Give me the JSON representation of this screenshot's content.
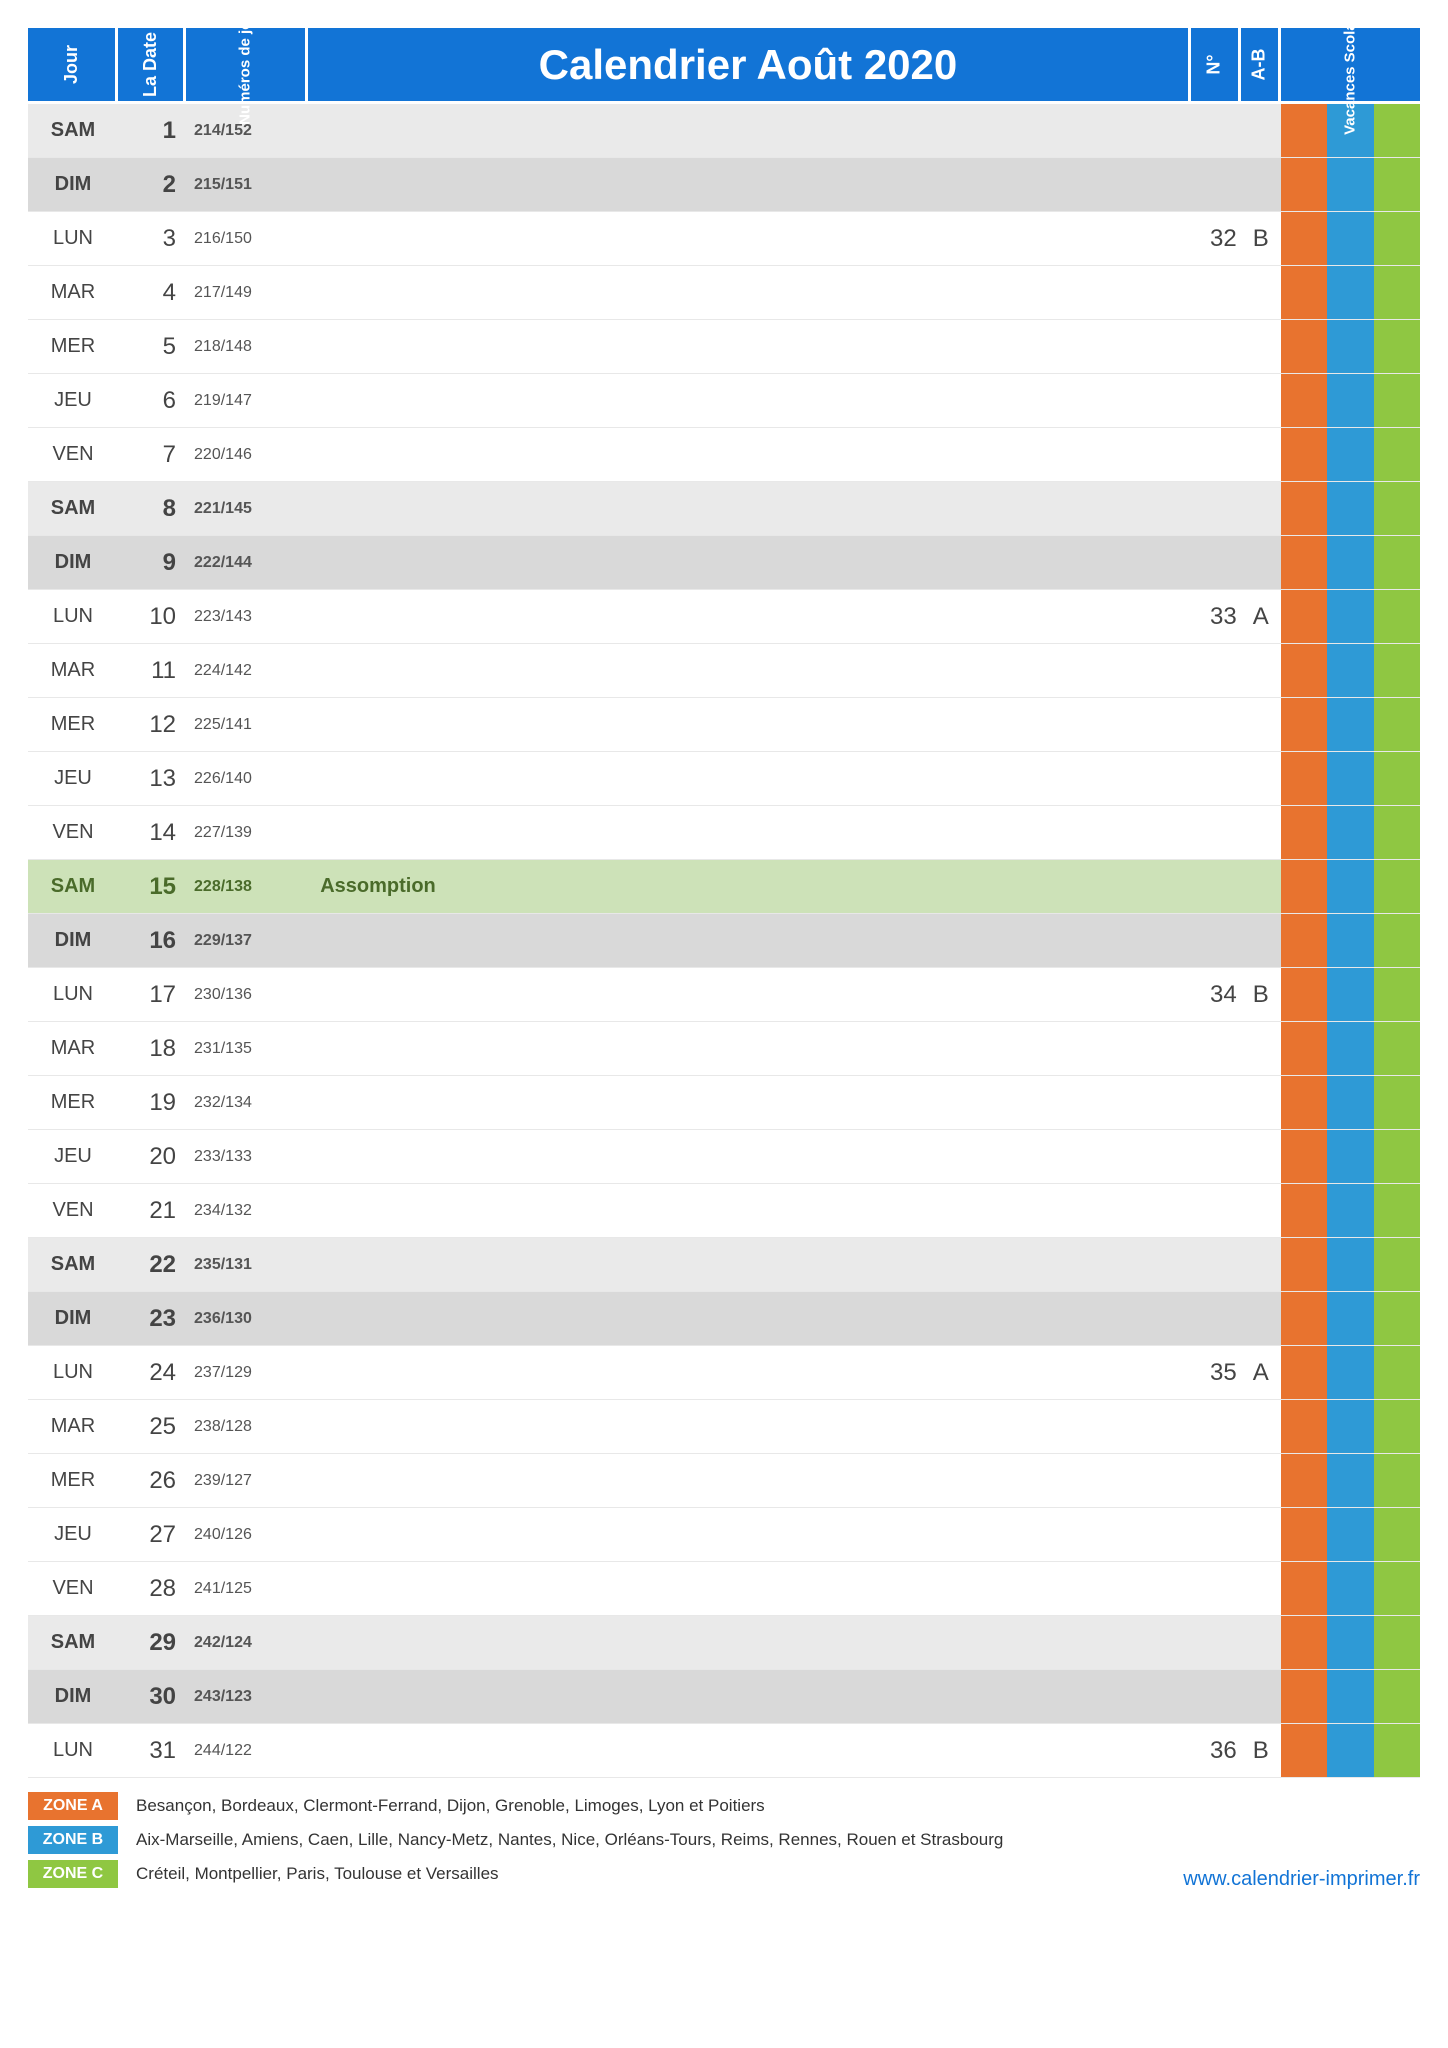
{
  "header": {
    "jour": "Jour",
    "date": "La Date",
    "numeros": "Numéros de jour",
    "title": "Calendrier Août 2020",
    "week": "N°",
    "ab": "A-B",
    "vacances": "Vacances Scolaires"
  },
  "zones": {
    "a_color": "#e8732f",
    "b_color": "#2e9ad6",
    "c_color": "#8fc742"
  },
  "rows": [
    {
      "day": "SAM",
      "date": "1",
      "num": "214/152",
      "event": "",
      "week": "",
      "ab": "",
      "type": "sat",
      "vac": [
        "a",
        "b",
        "c"
      ]
    },
    {
      "day": "DIM",
      "date": "2",
      "num": "215/151",
      "event": "",
      "week": "",
      "ab": "",
      "type": "sun",
      "vac": [
        "a",
        "b",
        "c"
      ]
    },
    {
      "day": "LUN",
      "date": "3",
      "num": "216/150",
      "event": "",
      "week": "32",
      "ab": "B",
      "type": "",
      "vac": [
        "a",
        "b",
        "c"
      ]
    },
    {
      "day": "MAR",
      "date": "4",
      "num": "217/149",
      "event": "",
      "week": "",
      "ab": "",
      "type": "",
      "vac": [
        "a",
        "b",
        "c"
      ]
    },
    {
      "day": "MER",
      "date": "5",
      "num": "218/148",
      "event": "",
      "week": "",
      "ab": "",
      "type": "",
      "vac": [
        "a",
        "b",
        "c"
      ]
    },
    {
      "day": "JEU",
      "date": "6",
      "num": "219/147",
      "event": "",
      "week": "",
      "ab": "",
      "type": "",
      "vac": [
        "a",
        "b",
        "c"
      ]
    },
    {
      "day": "VEN",
      "date": "7",
      "num": "220/146",
      "event": "",
      "week": "",
      "ab": "",
      "type": "",
      "vac": [
        "a",
        "b",
        "c"
      ]
    },
    {
      "day": "SAM",
      "date": "8",
      "num": "221/145",
      "event": "",
      "week": "",
      "ab": "",
      "type": "sat",
      "vac": [
        "a",
        "b",
        "c"
      ]
    },
    {
      "day": "DIM",
      "date": "9",
      "num": "222/144",
      "event": "",
      "week": "",
      "ab": "",
      "type": "sun",
      "vac": [
        "a",
        "b",
        "c"
      ]
    },
    {
      "day": "LUN",
      "date": "10",
      "num": "223/143",
      "event": "",
      "week": "33",
      "ab": "A",
      "type": "",
      "vac": [
        "a",
        "b",
        "c"
      ]
    },
    {
      "day": "MAR",
      "date": "11",
      "num": "224/142",
      "event": "",
      "week": "",
      "ab": "",
      "type": "",
      "vac": [
        "a",
        "b",
        "c"
      ]
    },
    {
      "day": "MER",
      "date": "12",
      "num": "225/141",
      "event": "",
      "week": "",
      "ab": "",
      "type": "",
      "vac": [
        "a",
        "b",
        "c"
      ]
    },
    {
      "day": "JEU",
      "date": "13",
      "num": "226/140",
      "event": "",
      "week": "",
      "ab": "",
      "type": "",
      "vac": [
        "a",
        "b",
        "c"
      ]
    },
    {
      "day": "VEN",
      "date": "14",
      "num": "227/139",
      "event": "",
      "week": "",
      "ab": "",
      "type": "",
      "vac": [
        "a",
        "b",
        "c"
      ]
    },
    {
      "day": "SAM",
      "date": "15",
      "num": "228/138",
      "event": "Assomption",
      "week": "",
      "ab": "",
      "type": "holiday",
      "vac": [
        "a",
        "b",
        "c"
      ]
    },
    {
      "day": "DIM",
      "date": "16",
      "num": "229/137",
      "event": "",
      "week": "",
      "ab": "",
      "type": "sun",
      "vac": [
        "a",
        "b",
        "c"
      ]
    },
    {
      "day": "LUN",
      "date": "17",
      "num": "230/136",
      "event": "",
      "week": "34",
      "ab": "B",
      "type": "",
      "vac": [
        "a",
        "b",
        "c"
      ]
    },
    {
      "day": "MAR",
      "date": "18",
      "num": "231/135",
      "event": "",
      "week": "",
      "ab": "",
      "type": "",
      "vac": [
        "a",
        "b",
        "c"
      ]
    },
    {
      "day": "MER",
      "date": "19",
      "num": "232/134",
      "event": "",
      "week": "",
      "ab": "",
      "type": "",
      "vac": [
        "a",
        "b",
        "c"
      ]
    },
    {
      "day": "JEU",
      "date": "20",
      "num": "233/133",
      "event": "",
      "week": "",
      "ab": "",
      "type": "",
      "vac": [
        "a",
        "b",
        "c"
      ]
    },
    {
      "day": "VEN",
      "date": "21",
      "num": "234/132",
      "event": "",
      "week": "",
      "ab": "",
      "type": "",
      "vac": [
        "a",
        "b",
        "c"
      ]
    },
    {
      "day": "SAM",
      "date": "22",
      "num": "235/131",
      "event": "",
      "week": "",
      "ab": "",
      "type": "sat",
      "vac": [
        "a",
        "b",
        "c"
      ]
    },
    {
      "day": "DIM",
      "date": "23",
      "num": "236/130",
      "event": "",
      "week": "",
      "ab": "",
      "type": "sun",
      "vac": [
        "a",
        "b",
        "c"
      ]
    },
    {
      "day": "LUN",
      "date": "24",
      "num": "237/129",
      "event": "",
      "week": "35",
      "ab": "A",
      "type": "",
      "vac": [
        "a",
        "b",
        "c"
      ]
    },
    {
      "day": "MAR",
      "date": "25",
      "num": "238/128",
      "event": "",
      "week": "",
      "ab": "",
      "type": "",
      "vac": [
        "a",
        "b",
        "c"
      ]
    },
    {
      "day": "MER",
      "date": "26",
      "num": "239/127",
      "event": "",
      "week": "",
      "ab": "",
      "type": "",
      "vac": [
        "a",
        "b",
        "c"
      ]
    },
    {
      "day": "JEU",
      "date": "27",
      "num": "240/126",
      "event": "",
      "week": "",
      "ab": "",
      "type": "",
      "vac": [
        "a",
        "b",
        "c"
      ]
    },
    {
      "day": "VEN",
      "date": "28",
      "num": "241/125",
      "event": "",
      "week": "",
      "ab": "",
      "type": "",
      "vac": [
        "a",
        "b",
        "c"
      ]
    },
    {
      "day": "SAM",
      "date": "29",
      "num": "242/124",
      "event": "",
      "week": "",
      "ab": "",
      "type": "sat",
      "vac": [
        "a",
        "b",
        "c"
      ]
    },
    {
      "day": "DIM",
      "date": "30",
      "num": "243/123",
      "event": "",
      "week": "",
      "ab": "",
      "type": "sun",
      "vac": [
        "a",
        "b",
        "c"
      ]
    },
    {
      "day": "LUN",
      "date": "31",
      "num": "244/122",
      "event": "",
      "week": "36",
      "ab": "B",
      "type": "",
      "vac": [
        "a",
        "b",
        "c"
      ]
    }
  ],
  "legend": {
    "a_label": "ZONE A",
    "a_text": "Besançon, Bordeaux, Clermont-Ferrand, Dijon, Grenoble, Limoges, Lyon et Poitiers",
    "b_label": "ZONE B",
    "b_text": "Aix-Marseille, Amiens, Caen, Lille, Nancy-Metz, Nantes, Nice, Orléans-Tours, Reims, Rennes, Rouen et Strasbourg",
    "c_label": "ZONE C",
    "c_text": "Créteil, Montpellier, Paris, Toulouse et Versailles"
  },
  "footer_url": "www.calendrier-imprimer.fr"
}
